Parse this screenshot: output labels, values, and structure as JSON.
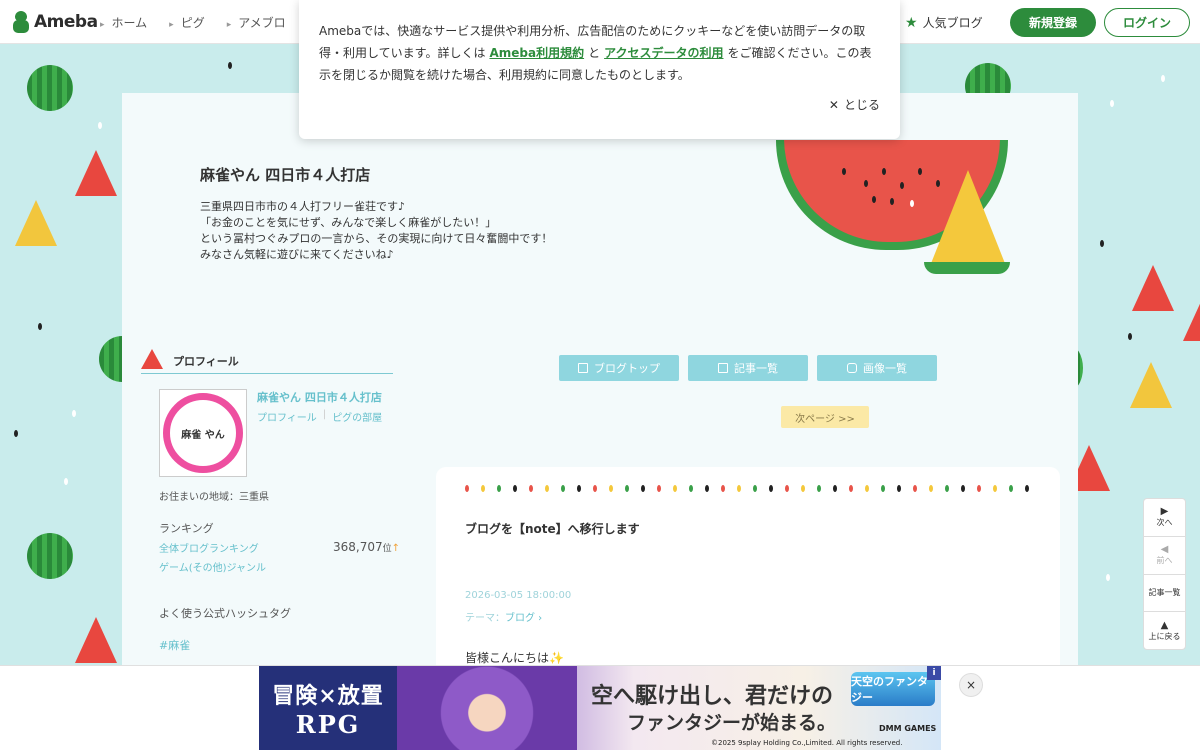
{
  "header": {
    "logo_text": "Ameba",
    "nav": [
      "ホーム",
      "ピグ",
      "アメブロ"
    ],
    "popular_blog": "人気ブログ",
    "signup": "新規登録",
    "login": "ログイン"
  },
  "cookie_banner": {
    "text_before": "Amebaでは、快適なサービス提供や利用分析、広告配信のためにクッキーなどを使い訪問データの取得・利用しています。詳しくは",
    "link1": "Ameba利用規約",
    "and": "と",
    "link2": "アクセスデータの利用",
    "text_after": "をご確認ください。この表示を閉じるか閲覧を続けた場合、利用規約に同意したものとします。",
    "close": "とじる"
  },
  "blog": {
    "title": "麻雀やん 四日市４人打店",
    "description": [
      "三重県四日市市の４人打フリー雀荘です♪",
      "「お金のことを気にせず、みんなで楽しく麻雀がしたい！」",
      "という冨村つぐみプロの一言から、その実現に向けて日々奮闘中です！",
      "みなさん気軽に遊びに来てくださいね♪"
    ]
  },
  "profile": {
    "heading": "プロフィール",
    "avatar_text": "麻雀 やん",
    "name": "麻雀やん 四日市４人打店",
    "link_profile": "プロフィール",
    "link_pigg": "ピグの部屋",
    "residence": "お住まいの地域：三重県",
    "ranking_title": "ランキング",
    "ranking_all": "全体ブログランキング",
    "ranking_genre": "ゲーム(その他)ジャンル",
    "ranking_value": "368,707",
    "ranking_suffix": "位",
    "hashtag_title": "よく使う公式ハッシュタグ",
    "hashtag": "#麻雀"
  },
  "blog_nav": {
    "top": "ブログトップ",
    "list": "記事一覧",
    "images": "画像一覧",
    "next_page": "次ページ >>"
  },
  "article": {
    "title": "ブログを【note】へ移行します",
    "date": "2026-03-05 18:00:00",
    "theme_label": "テーマ：",
    "theme": "ブログ",
    "greeting": "皆様こんにちは"
  },
  "side_nav": {
    "next": "次へ",
    "prev": "前へ",
    "list": "記事一覧",
    "top": "上に戻る"
  },
  "ad": {
    "left_line1": "冒険×放置",
    "left_line2": "RPG",
    "copy1": "空へ駆け出し、君だけの",
    "copy2": "ファンタジーが始まる。",
    "logo": "天空のファンタジー",
    "brand": "DMM GAMES",
    "copyright": "©2025 9splay Holding Co.,Limited. All rights reserved.",
    "info": "i",
    "close": "×"
  },
  "colors": {
    "brand_green": "#2d8c3c",
    "accent_teal": "#66c0cc",
    "background": "#c9ecec"
  }
}
